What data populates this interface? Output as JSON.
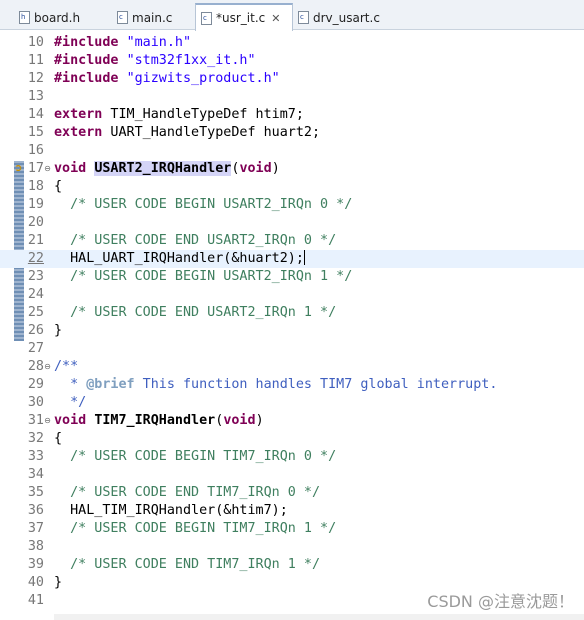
{
  "tabs": [
    {
      "icon": "h",
      "label": "board.h",
      "active": false
    },
    {
      "icon": "c",
      "label": "main.c",
      "active": false
    },
    {
      "icon": "c",
      "label": "*usr_it.c",
      "active": true,
      "close": "✕"
    },
    {
      "icon": "c",
      "label": "drv_usart.c",
      "active": false
    }
  ],
  "lines": [
    {
      "n": "10",
      "segs": [
        [
          "kw",
          "#include"
        ],
        [
          "",
          " "
        ],
        [
          "str",
          "\"main.h\""
        ]
      ]
    },
    {
      "n": "11",
      "segs": [
        [
          "kw",
          "#include"
        ],
        [
          "",
          " "
        ],
        [
          "str",
          "\"stm32f1xx_it.h\""
        ]
      ]
    },
    {
      "n": "12",
      "segs": [
        [
          "kw",
          "#include"
        ],
        [
          "",
          " "
        ],
        [
          "str",
          "\"gizwits_product.h\""
        ]
      ]
    },
    {
      "n": "13",
      "segs": []
    },
    {
      "n": "14",
      "segs": [
        [
          "kw",
          "extern"
        ],
        [
          "",
          " TIM_HandleTypeDef htim7;"
        ]
      ]
    },
    {
      "n": "15",
      "segs": [
        [
          "kw",
          "extern"
        ],
        [
          "",
          " UART_HandleTypeDef huart2;"
        ]
      ]
    },
    {
      "n": "16",
      "segs": []
    },
    {
      "n": "17",
      "fold": "⊖",
      "marker": true,
      "segs": [
        [
          "kw",
          "void"
        ],
        [
          "",
          " "
        ],
        [
          "fn hl",
          "USART2_IRQHandler"
        ],
        [
          "",
          "("
        ],
        [
          "kw",
          "void"
        ],
        [
          "",
          ")"
        ]
      ]
    },
    {
      "n": "18",
      "segs": [
        [
          "",
          "{"
        ]
      ]
    },
    {
      "n": "19",
      "segs": [
        [
          "",
          "  "
        ],
        [
          "cm",
          "/* USER CODE BEGIN USART2_IRQn 0 */"
        ]
      ]
    },
    {
      "n": "20",
      "segs": []
    },
    {
      "n": "21",
      "segs": [
        [
          "",
          "  "
        ],
        [
          "cm",
          "/* USER CODE END USART2_IRQn 0 */"
        ]
      ]
    },
    {
      "n": "22",
      "current": true,
      "segs": [
        [
          "",
          "  HAL_UART_IRQHandler(&huart2);"
        ]
      ]
    },
    {
      "n": "23",
      "segs": [
        [
          "",
          "  "
        ],
        [
          "cm",
          "/* USER CODE BEGIN USART2_IRQn 1 */"
        ]
      ]
    },
    {
      "n": "24",
      "segs": []
    },
    {
      "n": "25",
      "segs": [
        [
          "",
          "  "
        ],
        [
          "cm",
          "/* USER CODE END USART2_IRQn 1 */"
        ]
      ]
    },
    {
      "n": "26",
      "segs": [
        [
          "",
          "}"
        ]
      ]
    },
    {
      "n": "27",
      "segs": []
    },
    {
      "n": "28",
      "fold": "⊖",
      "segs": [
        [
          "jd",
          "/**"
        ]
      ]
    },
    {
      "n": "29",
      "segs": [
        [
          "jd",
          "  * "
        ],
        [
          "jdtag",
          "@brief"
        ],
        [
          "jd",
          " This function handles TIM7 global interrupt."
        ]
      ]
    },
    {
      "n": "30",
      "segs": [
        [
          "jd",
          "  */"
        ]
      ]
    },
    {
      "n": "31",
      "fold": "⊖",
      "segs": [
        [
          "kw",
          "void"
        ],
        [
          "",
          " "
        ],
        [
          "fn",
          "TIM7_IRQHandler"
        ],
        [
          "",
          "("
        ],
        [
          "kw",
          "void"
        ],
        [
          "",
          ")"
        ]
      ]
    },
    {
      "n": "32",
      "segs": [
        [
          "",
          "{"
        ]
      ]
    },
    {
      "n": "33",
      "segs": [
        [
          "",
          "  "
        ],
        [
          "cm",
          "/* USER CODE BEGIN TIM7_IRQn 0 */"
        ]
      ]
    },
    {
      "n": "34",
      "segs": []
    },
    {
      "n": "35",
      "segs": [
        [
          "",
          "  "
        ],
        [
          "cm",
          "/* USER CODE END TIM7_IRQn 0 */"
        ]
      ]
    },
    {
      "n": "36",
      "segs": [
        [
          "",
          "  HAL_TIM_IRQHandler(&htim7);"
        ]
      ]
    },
    {
      "n": "37",
      "segs": [
        [
          "",
          "  "
        ],
        [
          "cm",
          "/* USER CODE BEGIN TIM7_IRQn 1 */"
        ]
      ]
    },
    {
      "n": "38",
      "segs": []
    },
    {
      "n": "39",
      "segs": [
        [
          "",
          "  "
        ],
        [
          "cm",
          "/* USER CODE END TIM7_IRQn 1 */"
        ]
      ]
    },
    {
      "n": "40",
      "segs": [
        [
          "",
          "}"
        ]
      ]
    },
    {
      "n": "41",
      "segs": []
    }
  ],
  "watermark": "CSDN @注意沈题！",
  "colors": {
    "keyword": "#7f0055",
    "string": "#2a00ff",
    "comment": "#3f7f5f",
    "javadoc": "#3f5fbf",
    "current_line": "#e8f2fe",
    "highlight": "#d4d4f7"
  }
}
